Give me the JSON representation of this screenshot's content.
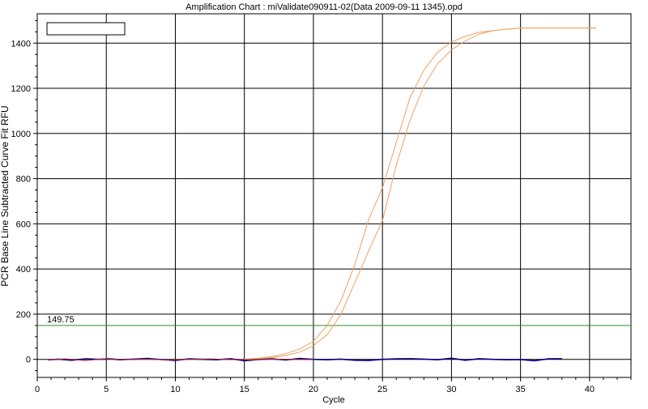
{
  "chart_data": {
    "type": "line",
    "title": "Amplification Chart : miValidate090911-02(Data 2009-09-11 1345).opd",
    "xlabel": "Cycle",
    "ylabel": "PCR Base Line Subtracted Curve Fit RFU",
    "xlim": [
      0,
      43
    ],
    "ylim": [
      -80,
      1530
    ],
    "x_ticks": [
      0,
      5,
      10,
      15,
      20,
      25,
      30,
      35,
      40
    ],
    "y_ticks": [
      0,
      200,
      400,
      600,
      800,
      1000,
      1200,
      1400
    ],
    "grid": true,
    "legend": "top-left (empty box)",
    "threshold": {
      "value": 149.75,
      "label": "149.75",
      "color": "#2e8b2e"
    },
    "series": [
      {
        "color": "#f0a060",
        "x": [
          15,
          16,
          17,
          18,
          19,
          20,
          21,
          22,
          23,
          24,
          25,
          26,
          27,
          28,
          29,
          30,
          31,
          32,
          33,
          34,
          35,
          36,
          37,
          38,
          39,
          40,
          40.5
        ],
        "y": [
          1,
          5,
          12,
          25,
          45,
          80,
          150,
          260,
          420,
          620,
          760,
          960,
          1160,
          1280,
          1360,
          1405,
          1430,
          1448,
          1455,
          1462,
          1466,
          1467,
          1467,
          1467,
          1467,
          1467,
          1467
        ]
      },
      {
        "color": "#f0a060",
        "x": [
          15,
          16,
          17,
          18,
          19,
          20,
          21,
          22,
          23,
          24,
          25,
          26,
          27,
          28,
          29,
          30,
          31,
          32,
          33,
          34,
          35,
          36,
          37,
          38,
          39,
          40,
          40.5
        ],
        "y": [
          0,
          3,
          8,
          17,
          32,
          60,
          110,
          200,
          340,
          480,
          615,
          860,
          1060,
          1210,
          1310,
          1370,
          1410,
          1440,
          1455,
          1462,
          1466,
          1467,
          1467,
          1467,
          1467,
          1467,
          1467
        ]
      },
      {
        "color": "#000080",
        "x": [
          0.8,
          1.5,
          2.5,
          3.5,
          4.5,
          5.2,
          6,
          7,
          8,
          9,
          10,
          11,
          12,
          13,
          14,
          15,
          16,
          17,
          18,
          19,
          20,
          21,
          22,
          23,
          24,
          25,
          26,
          27,
          28,
          29,
          30,
          31,
          32,
          33,
          34,
          35,
          36,
          37,
          38
        ],
        "y": [
          -3,
          1,
          -4,
          2,
          0,
          3,
          -2,
          1,
          4,
          -1,
          -5,
          2,
          0,
          -2,
          3,
          -6,
          -1,
          2,
          -3,
          4,
          0,
          -2,
          1,
          -4,
          -5,
          0,
          2,
          3,
          1,
          -2,
          5,
          -4,
          3,
          0,
          -2,
          -1,
          -6,
          2,
          3
        ]
      },
      {
        "color": "#b02030",
        "x": [
          0.8,
          2,
          3.5,
          5,
          6.5,
          8,
          9.5,
          11,
          12.5,
          14,
          15.5,
          17,
          18.5,
          20
        ],
        "y": [
          -2,
          2,
          -5,
          3,
          -1,
          1,
          -3,
          0,
          2,
          -1,
          -2,
          1,
          0,
          -1
        ]
      }
    ]
  }
}
